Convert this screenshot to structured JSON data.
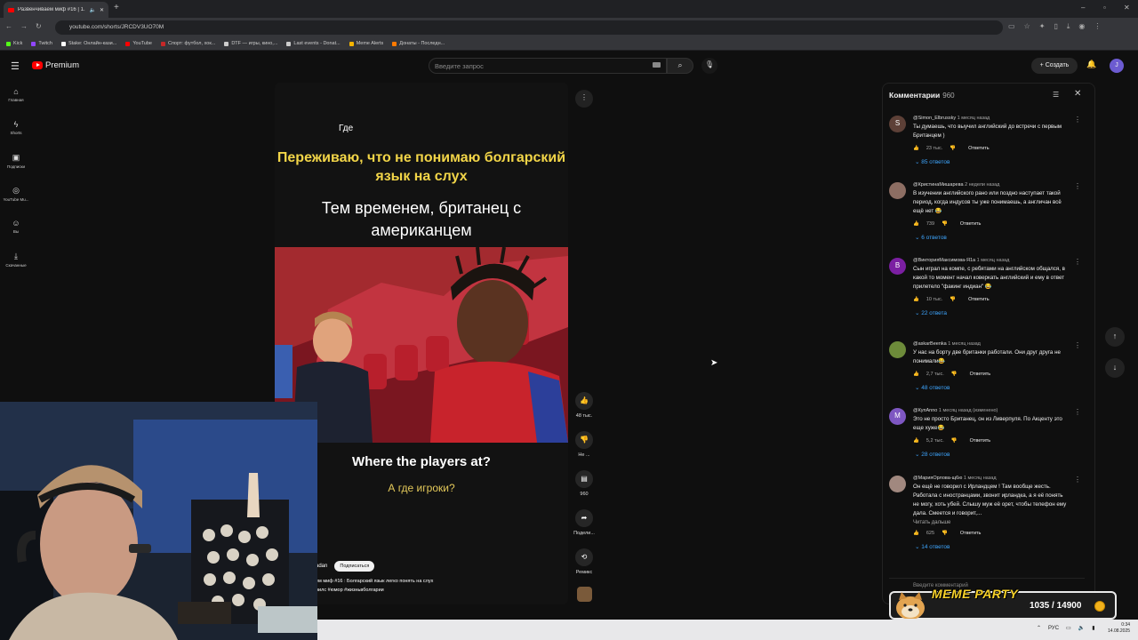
{
  "browser": {
    "tab_title": "Развенчиваем миф #16 | 1...",
    "url": "youtube.com/shorts/JRCDV3UO70M",
    "bookmarks": [
      {
        "label": "Kick",
        "color": "#53fc18"
      },
      {
        "label": "Twitch",
        "color": "#9146ff"
      },
      {
        "label": "Stake: Онлайн-кази...",
        "color": "#ffffff"
      },
      {
        "label": "YouTube",
        "color": "#ff0000"
      },
      {
        "label": "Спорт: футбол, хок...",
        "color": "#c62828"
      },
      {
        "label": "DTF — игры, кино,...",
        "color": "#cccccc"
      },
      {
        "label": "Last events - Donat...",
        "color": "#cccccc"
      },
      {
        "label": "Meme Alerts",
        "color": "#f4b400"
      },
      {
        "label": "Донаты - Последн...",
        "color": "#ff7a00"
      }
    ]
  },
  "header": {
    "logo": "Premium",
    "search_placeholder": "Введите запрос",
    "create_label": "Создать",
    "avatar_letter": "J"
  },
  "sidebar": [
    {
      "label": "Главная",
      "icon": "⌂"
    },
    {
      "label": "Shorts",
      "icon": "ϟ"
    },
    {
      "label": "Подписки",
      "icon": "▣"
    },
    {
      "label": "YouTube Mu...",
      "icon": "◎"
    },
    {
      "label": "Вы",
      "icon": "☺"
    },
    {
      "label": "Скачанные",
      "icon": "⤓"
    }
  ],
  "video": {
    "text_where": "Где",
    "caption_yellow": "Переживаю, что не понимаю болгарский язык на слух",
    "caption_white": "Тем временем, британец с американцем",
    "subtitle_en": "Where the players at?",
    "subtitle_ru": "А где игроки?",
    "channel": "adan",
    "subscribe": "Подписаться",
    "title_line1": "ем миф #16 : Болгарский язык легко понять на слух",
    "title_line2": "рилс #юмор #жизньвболгарии"
  },
  "actions": {
    "likes": "48 тыс.",
    "dislike": "Не ...",
    "comments": "960",
    "share": "Подели...",
    "remix": "Ремикс"
  },
  "comments": {
    "title": "Комментарии",
    "count": "960",
    "input_placeholder": "Введите комментарий",
    "items": [
      {
        "letter": "S",
        "color": "#5d4037",
        "author": "@Simon_Elbrussky",
        "time": "1 месяц назад",
        "text": "Ты думаешь, что выучил английский до встречи с первым Британцем )",
        "likes": "23 тыс.",
        "reply": "Ответить",
        "replies": "85 ответов",
        "more": ""
      },
      {
        "letter": "",
        "color": "#8d6e63",
        "author": "@КристинаМишарева",
        "time": "2 недели назад",
        "text": "В изучении английского рано или поздно наступает такой период, когда индусов ты уже понимаешь, а англичан всё ещё нет 😂",
        "likes": "739",
        "reply": "Ответить",
        "replies": "6 ответов",
        "more": ""
      },
      {
        "letter": "B",
        "color": "#7b1fa2",
        "author": "@ВикторияМаксимова-Я1а",
        "time": "1 месяц назад",
        "text": "Сын играл на компе, с ребятами на английском общался, в какой то момент начал коверкать английский и ему в ответ прилетело \"факинг индиан\" 😂",
        "likes": "10 тыс.",
        "reply": "Ответить",
        "replies": "22 ответа",
        "more": ""
      },
      {
        "letter": "",
        "color": "#6d8b3a",
        "author": "@askarBeenka",
        "time": "1 месяц назад",
        "text": "У нас на борту две британки работали. Они друг друга не понимали😂",
        "likes": "2,7 тыс.",
        "reply": "Ответить",
        "replies": "48 ответов",
        "more": ""
      },
      {
        "letter": "M",
        "color": "#7e57c2",
        "author": "@КупAnno",
        "time": "1 месяц назад (изменено)",
        "text": "Это не просто Британец, он из Ливерпуля. По Акценту это еще хуже😂",
        "likes": "5,2 тыс.",
        "reply": "Ответить",
        "replies": "28 ответов",
        "more": ""
      },
      {
        "letter": "",
        "color": "#a1887f",
        "author": "@МарияОрлова-щ6ю",
        "time": "1 месяц назад",
        "text": "Он ещё не говорил с Ирландцем ! Там вообще жесть. Работала с иностранцами, звонит ирландка, а я её понять не могу, хоть убей. Слышу муж её орет, чтобы телефон ему дала. Смеется и говорит,...",
        "likes": "625",
        "reply": "Ответить",
        "replies": "14 ответов",
        "more": "Читать дальше"
      }
    ]
  },
  "overlay": {
    "title": "MEME PARTY",
    "progress": "1035 / 14900"
  },
  "taskbar": {
    "lang": "РУС",
    "time": "0:34",
    "date": "14.08.2025"
  }
}
